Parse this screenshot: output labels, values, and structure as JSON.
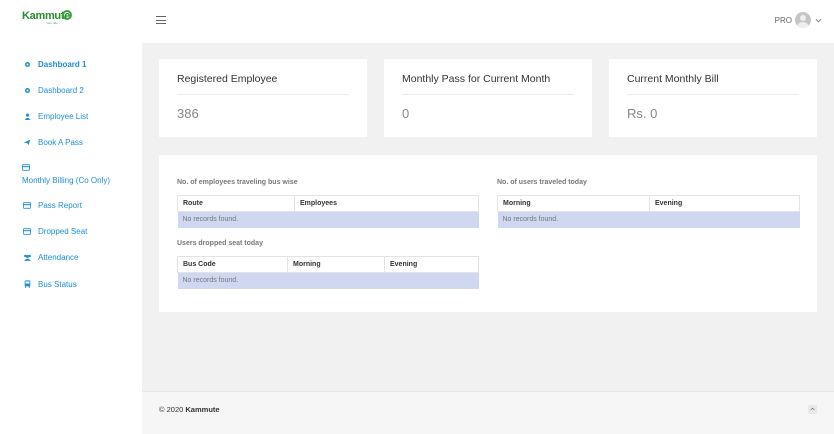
{
  "brand": {
    "logo_text": "Kammute",
    "logo_tag": "Your ride"
  },
  "sidebar": {
    "items": [
      {
        "label": "Dashboard 1",
        "icon": "gear-icon"
      },
      {
        "label": "Dashboard 2",
        "icon": "gear-icon"
      },
      {
        "label": "Employee List",
        "icon": "user-icon"
      },
      {
        "label": "Book A Pass",
        "icon": "plane-icon"
      },
      {
        "label": "Monthly Billing (Co Only)",
        "icon": "credit-card-icon"
      },
      {
        "label": "Pass Report",
        "icon": "credit-card-icon"
      },
      {
        "label": "Dropped Seat",
        "icon": "credit-card-icon"
      },
      {
        "label": "Attendance",
        "icon": "users-icon"
      },
      {
        "label": "Bus Status",
        "icon": "bus-icon"
      }
    ]
  },
  "header": {
    "user_label": "PRO"
  },
  "cards": [
    {
      "title": "Registered Employee",
      "value": "386"
    },
    {
      "title": "Monthly Pass for Current Month",
      "value": "0"
    },
    {
      "title": "Current Monthly Bill",
      "value": "Rs. 0"
    }
  ],
  "tables": {
    "bus_wise": {
      "title": "No. of employees traveling bus wise",
      "columns": [
        "Route",
        "Employees"
      ],
      "empty": "No records found."
    },
    "travelled_today": {
      "title": "No. of users traveled today",
      "columns": [
        "Morning",
        "Evening"
      ],
      "empty": "No records found."
    },
    "dropped_seat": {
      "title": "Users dropped seat today",
      "columns": [
        "Bus Code",
        "Morning",
        "Evening"
      ],
      "empty": "No records found."
    }
  },
  "footer": {
    "copyright_prefix": "© 2020",
    "company": "Kammute"
  },
  "colors": {
    "accent": "#1e8fd8",
    "brand": "#2b8a2f",
    "empty_row": "#cfd8f0"
  }
}
